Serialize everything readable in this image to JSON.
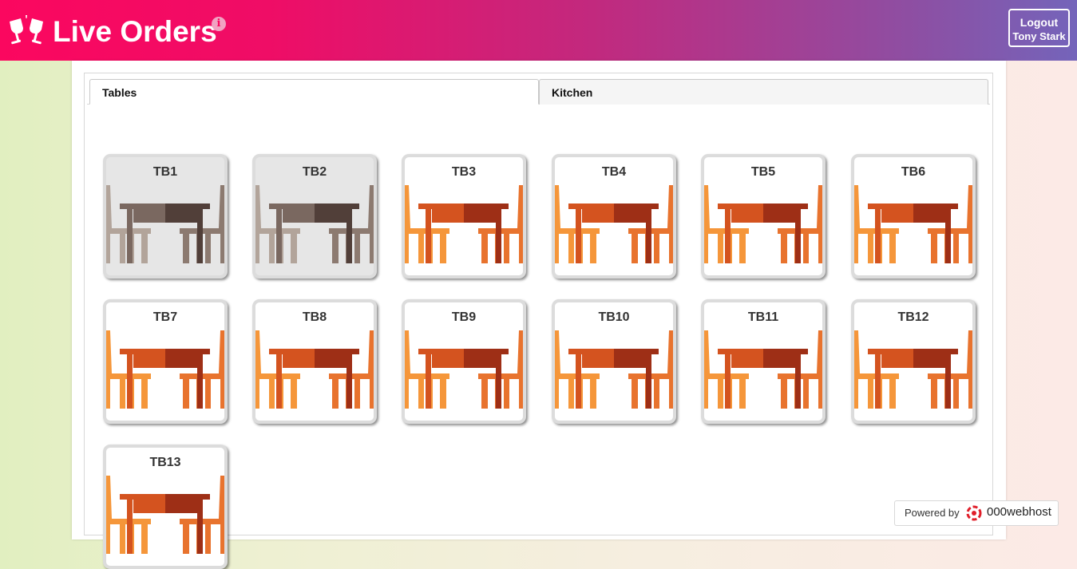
{
  "header": {
    "title": "Live Orders",
    "logo_icon": "cheers-glasses-icon",
    "info_icon": "info-icon",
    "info_glyph": "i",
    "logout_label": "Logout",
    "user_name": "Tony Stark",
    "colors": {
      "gradient_start": "#fb075f",
      "gradient_end": "#7464ba"
    }
  },
  "tabs": [
    {
      "label": "Tables",
      "active": true
    },
    {
      "label": "Kitchen",
      "active": false
    }
  ],
  "tables": [
    {
      "label": "TB1",
      "status": "occupied"
    },
    {
      "label": "TB2",
      "status": "occupied"
    },
    {
      "label": "TB3",
      "status": "available"
    },
    {
      "label": "TB4",
      "status": "available"
    },
    {
      "label": "TB5",
      "status": "available"
    },
    {
      "label": "TB6",
      "status": "available"
    },
    {
      "label": "TB7",
      "status": "available"
    },
    {
      "label": "TB8",
      "status": "available"
    },
    {
      "label": "TB9",
      "status": "available"
    },
    {
      "label": "TB10",
      "status": "available"
    },
    {
      "label": "TB11",
      "status": "available"
    },
    {
      "label": "TB12",
      "status": "available"
    },
    {
      "label": "TB13",
      "status": "available"
    }
  ],
  "table_icon": "dining-table-icon",
  "table_colors": {
    "available": {
      "chair_light": "#f5963a",
      "chair_mid": "#e8732e",
      "table_top": "#d4531f",
      "table_dark": "#9e2f16"
    },
    "occupied": {
      "chair_light": "#b2a49a",
      "chair_mid": "#8c7a70",
      "table_top": "#7a6860",
      "table_dark": "#513f39"
    }
  },
  "footer": {
    "powered_by": "Powered by",
    "host": "000webhost",
    "host_icon": "000webhost-logo-icon"
  }
}
